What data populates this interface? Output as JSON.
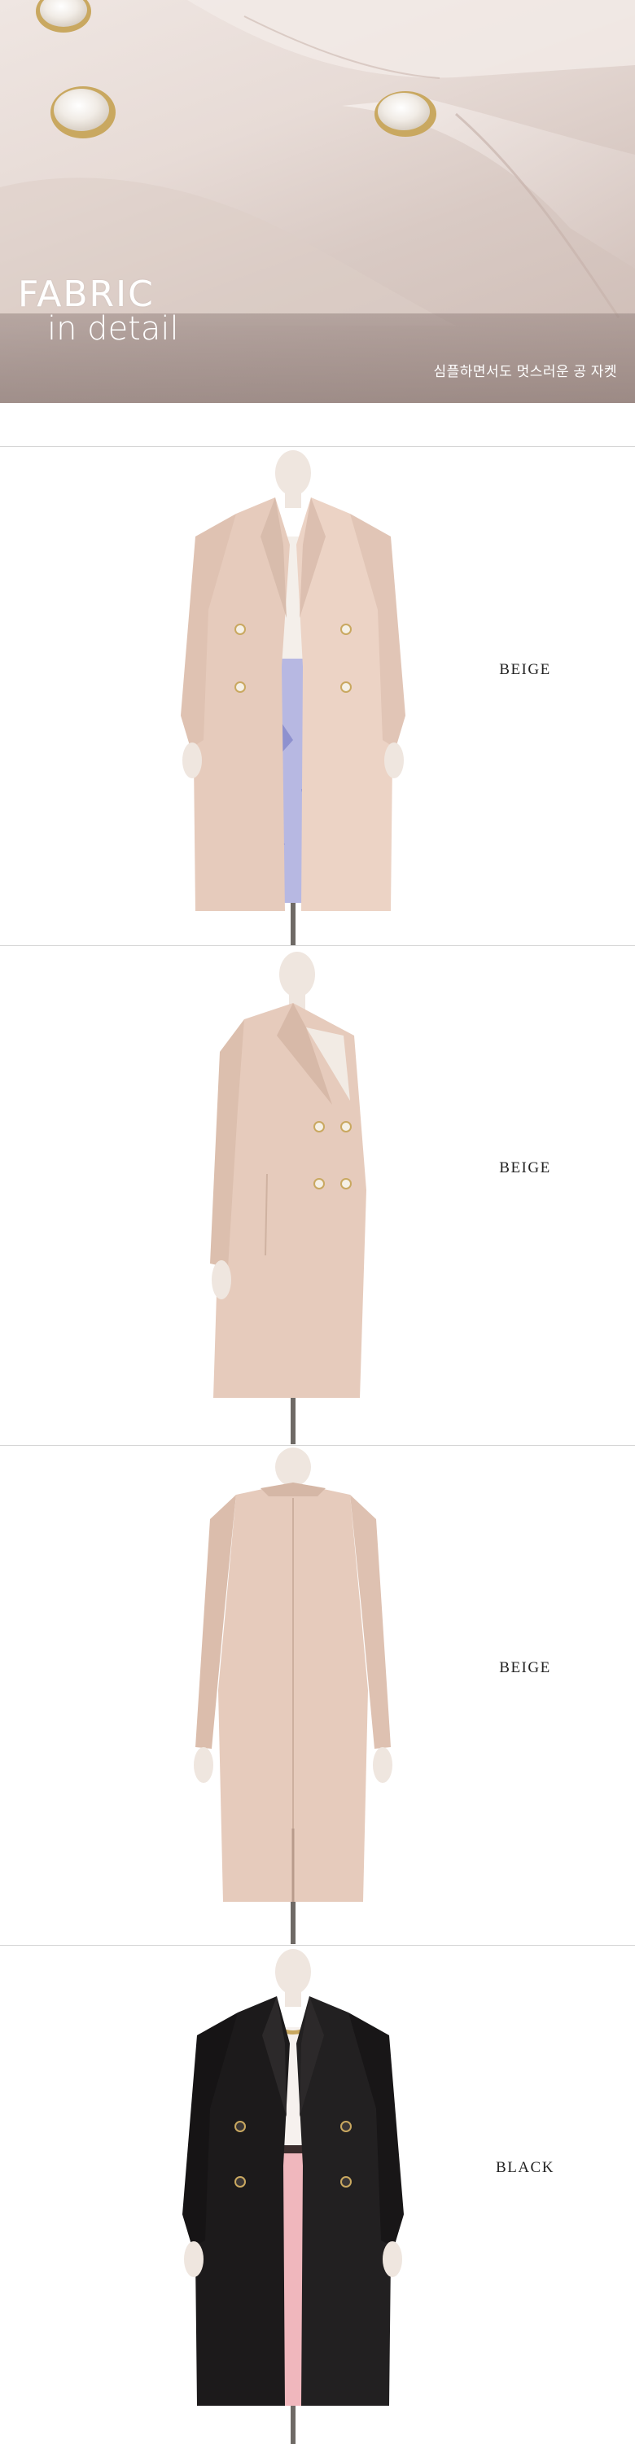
{
  "hero": {
    "title": "FABRIC",
    "subtitle": "in detail",
    "caption": "심플하면서도 멋스러운 공 자켓"
  },
  "panels": [
    {
      "color_label": "BEIGE",
      "view": "front",
      "coat_color": "#e6cbbc",
      "inner_top": "#f4efea",
      "inner_bottom": "#b7b8e2"
    },
    {
      "color_label": "BEIGE",
      "view": "side",
      "coat_color": "#e6cbbc",
      "inner_top": "#f4efea",
      "inner_bottom": "#e6cbbc"
    },
    {
      "color_label": "BEIGE",
      "view": "back",
      "coat_color": "#e6cbbc",
      "inner_top": "#e6cbbc",
      "inner_bottom": "#e6cbbc"
    },
    {
      "color_label": "BLACK",
      "view": "front",
      "coat_color": "#1c1a1b",
      "inner_top": "#f6f1ee",
      "inner_bottom": "#f0b7bd"
    }
  ],
  "colors": {
    "beige": "#e6cbbc",
    "black": "#1c1a1b",
    "divider": "#d6d6d6"
  }
}
